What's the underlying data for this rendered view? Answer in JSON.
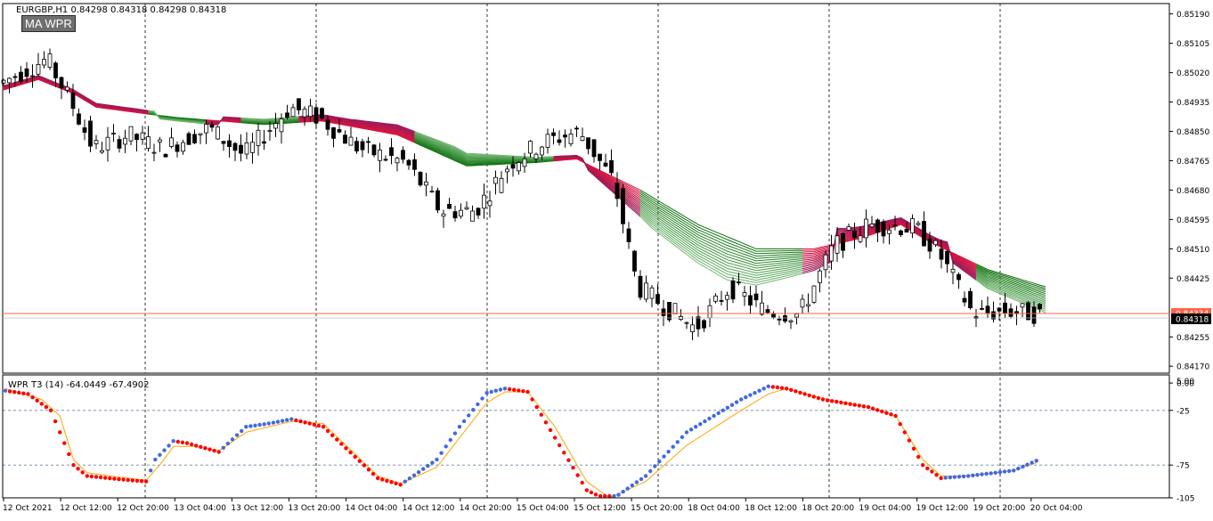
{
  "header": {
    "symbol_line": "EURGBP,H1  0.84298 0.84318 0.84298 0.84318",
    "indicator_badge": "MA WPR"
  },
  "subwindow": {
    "title": "WPR T3 (14) -64.0449 -67.4902"
  },
  "price_axis": {
    "ticks": [
      "0.85190",
      "0.85105",
      "0.85020",
      "0.84935",
      "0.84850",
      "0.84765",
      "0.84680",
      "0.84595",
      "0.84510",
      "0.84425",
      "0.84255",
      "0.84170"
    ],
    "current_price_label": "0.84318",
    "line_price_label": "0.84334"
  },
  "wpr_axis": {
    "ticks": [
      "0.00",
      "-25",
      "-75",
      "-105"
    ],
    "top_partial_label": "5.00"
  },
  "time_axis": {
    "labels": [
      "12 Oct 2021",
      "12 Oct 12:00",
      "12 Oct 20:00",
      "13 Oct 04:00",
      "13 Oct 12:00",
      "13 Oct 20:00",
      "14 Oct 04:00",
      "14 Oct 12:00",
      "14 Oct 20:00",
      "15 Oct 04:00",
      "15 Oct 12:00",
      "15 Oct 20:00",
      "18 Oct 04:00",
      "18 Oct 12:00",
      "18 Oct 20:00",
      "19 Oct 04:00",
      "19 Oct 12:00",
      "19 Oct 20:00",
      "20 Oct 04:00"
    ]
  },
  "colors": {
    "background": "#ffffff",
    "grid": "#000000",
    "ribbon_bull": "#006400",
    "ribbon_bear": "#dc143c",
    "wpr_up_dots": "#4169e1",
    "wpr_down_dots": "#ff0000",
    "signal_line": "#ffa500",
    "price_line": "#ff6347",
    "level_lines": "#6688aa"
  },
  "chart_data": [
    {
      "type": "candlestick",
      "title": "EURGBP,H1",
      "ylim": [
        0.8415,
        0.8522
      ],
      "ma_ribbon": {
        "count": 16,
        "keypoints": [
          [
            0,
            0.8497
          ],
          [
            6,
            0.85
          ],
          [
            12,
            0.8496
          ],
          [
            16,
            0.8492
          ],
          [
            25,
            0.849
          ],
          [
            30,
            0.8489
          ],
          [
            45,
            0.8487
          ],
          [
            55,
            0.8488
          ],
          [
            68,
            0.8484
          ],
          [
            80,
            0.8475
          ],
          [
            92,
            0.8476
          ],
          [
            99,
            0.8477
          ],
          [
            110,
            0.8468
          ],
          [
            120,
            0.8458
          ],
          [
            130,
            0.8451
          ],
          [
            140,
            0.8451
          ],
          [
            148,
            0.8454
          ],
          [
            155,
            0.8458
          ],
          [
            160,
            0.8453
          ],
          [
            170,
            0.8445
          ],
          [
            180,
            0.844
          ]
        ],
        "spread_keypoints": [
          [
            0,
            0.00012
          ],
          [
            30,
            0.0001
          ],
          [
            60,
            0.0002
          ],
          [
            78,
            0.0004
          ],
          [
            92,
            0.00015
          ],
          [
            100,
            0.0001
          ],
          [
            112,
            0.0009
          ],
          [
            125,
            0.00125
          ],
          [
            135,
            0.00085
          ],
          [
            145,
            0.0004
          ],
          [
            155,
            0.0002
          ],
          [
            162,
            0.0002
          ],
          [
            170,
            0.00055
          ],
          [
            180,
            0.00075
          ]
        ],
        "direction_keypoints": [
          [
            0,
            0.8497
          ],
          [
            6,
            0.85
          ],
          [
            12,
            0.8496
          ],
          [
            16,
            0.8492
          ],
          [
            22,
            0.8492
          ],
          [
            30,
            0.8488
          ],
          [
            45,
            0.8488
          ],
          [
            55,
            0.8488
          ],
          [
            68,
            0.8484
          ],
          [
            80,
            0.8476
          ],
          [
            92,
            0.8477
          ],
          [
            99,
            0.8479
          ],
          [
            110,
            0.8455
          ],
          [
            120,
            0.8445
          ],
          [
            130,
            0.8441
          ],
          [
            140,
            0.8449
          ],
          [
            148,
            0.8456
          ],
          [
            155,
            0.8458
          ],
          [
            160,
            0.8455
          ],
          [
            170,
            0.8442
          ],
          [
            180,
            0.8432
          ]
        ],
        "color_segments": [
          [
            0,
            24,
            "bear"
          ],
          [
            25,
            34,
            "bull"
          ],
          [
            35,
            40,
            "bear"
          ],
          [
            41,
            50,
            "bull"
          ],
          [
            51,
            70,
            "bear"
          ],
          [
            71,
            94,
            "bull"
          ],
          [
            95,
            109,
            "bear"
          ],
          [
            110,
            137,
            "bull"
          ],
          [
            138,
            167,
            "bear"
          ],
          [
            168,
            180,
            "bull"
          ]
        ]
      }
    },
    {
      "type": "line",
      "title": "WPR T3 (14) -64.0449 -67.4902",
      "ylim": [
        -105,
        5
      ],
      "levels": [
        -25,
        -75
      ],
      "wpr_keypoints": [
        [
          0,
          -7
        ],
        [
          5,
          -10
        ],
        [
          10,
          -25
        ],
        [
          15,
          -75
        ],
        [
          18,
          -85
        ],
        [
          25,
          -88
        ],
        [
          31,
          -90
        ],
        [
          33,
          -70
        ],
        [
          37,
          -53
        ],
        [
          40,
          -55
        ],
        [
          47,
          -63
        ],
        [
          53,
          -40
        ],
        [
          58,
          -37
        ],
        [
          63,
          -33
        ],
        [
          70,
          -40
        ],
        [
          82,
          -87
        ],
        [
          87,
          -93
        ],
        [
          95,
          -70
        ],
        [
          100,
          -40
        ],
        [
          106,
          -9
        ],
        [
          110,
          -5
        ],
        [
          115,
          -8
        ],
        [
          121,
          -50
        ],
        [
          128,
          -98
        ],
        [
          133,
          -108
        ],
        [
          141,
          -85
        ],
        [
          150,
          -45
        ],
        [
          162,
          -15
        ],
        [
          168,
          -3
        ],
        [
          172,
          -5
        ],
        [
          180,
          -15
        ],
        [
          190,
          -22
        ],
        [
          196,
          -30
        ],
        [
          202,
          -75
        ],
        [
          206,
          -87
        ],
        [
          212,
          -85
        ],
        [
          222,
          -80
        ],
        [
          227,
          -71
        ]
      ],
      "signal_keypoints": [
        [
          0,
          -5
        ],
        [
          8,
          -15
        ],
        [
          12,
          -30
        ],
        [
          15,
          -70
        ],
        [
          18,
          -82
        ],
        [
          25,
          -86
        ],
        [
          31,
          -89
        ],
        [
          34,
          -75
        ],
        [
          37,
          -58
        ],
        [
          42,
          -58
        ],
        [
          47,
          -62
        ],
        [
          53,
          -45
        ],
        [
          58,
          -40
        ],
        [
          63,
          -35
        ],
        [
          70,
          -37
        ],
        [
          82,
          -85
        ],
        [
          87,
          -92
        ],
        [
          95,
          -77
        ],
        [
          100,
          -50
        ],
        [
          106,
          -18
        ],
        [
          110,
          -8
        ],
        [
          115,
          -8
        ],
        [
          121,
          -40
        ],
        [
          128,
          -90
        ],
        [
          133,
          -105
        ],
        [
          141,
          -90
        ],
        [
          150,
          -57
        ],
        [
          162,
          -25
        ],
        [
          168,
          -10
        ],
        [
          172,
          -5
        ],
        [
          180,
          -14
        ],
        [
          190,
          -22
        ],
        [
          196,
          -30
        ],
        [
          202,
          -70
        ],
        [
          206,
          -85
        ],
        [
          212,
          -85
        ],
        [
          222,
          -80
        ],
        [
          227,
          -73
        ]
      ]
    }
  ]
}
